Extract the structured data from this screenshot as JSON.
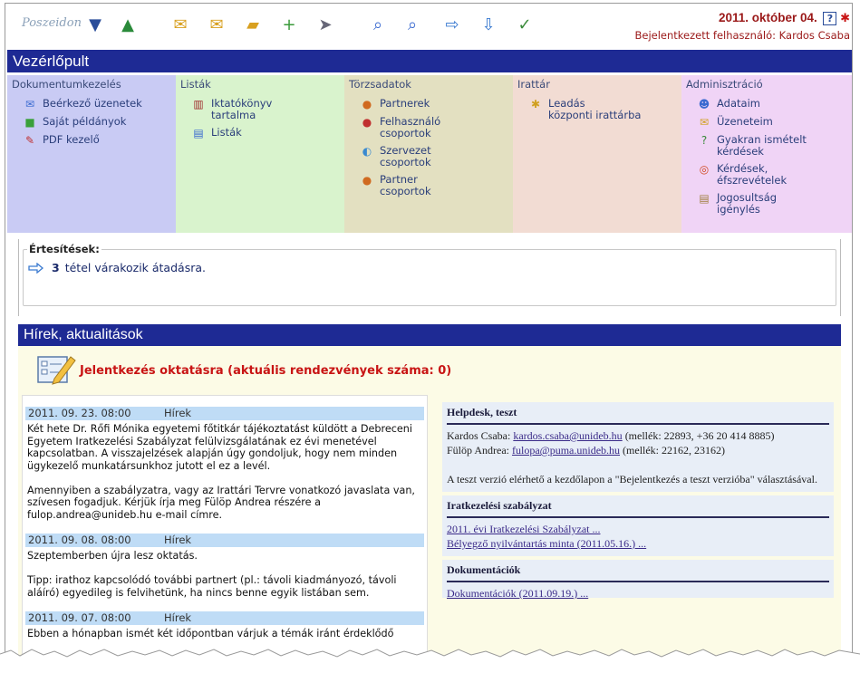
{
  "logo": {
    "text": "Poszeidon"
  },
  "header": {
    "date": "2011. október 04.",
    "user": "Bejelentkezett felhasználó: Kardos Csaba",
    "help_label": "?"
  },
  "icons": {
    "help": "help-icon",
    "logout": "logout-icon"
  },
  "toolbar": [
    {
      "name": "incoming-doc-icon",
      "glyph": "▼"
    },
    {
      "name": "outgoing-doc-icon",
      "glyph": "▲"
    },
    {
      "name": "folder-mail-icon",
      "glyph": "✉"
    },
    {
      "name": "folder-open-mail-icon",
      "glyph": "✉"
    },
    {
      "name": "folder-icon",
      "glyph": "▰"
    },
    {
      "name": "folder-add-icon",
      "glyph": "+"
    },
    {
      "name": "send-icon",
      "glyph": "➤"
    },
    {
      "name": "search-icon",
      "glyph": "⌕"
    },
    {
      "name": "search-detail-icon",
      "glyph": "⌕"
    },
    {
      "name": "arrow-right-icon",
      "glyph": "⇨"
    },
    {
      "name": "arrow-down-icon",
      "glyph": "⇩"
    },
    {
      "name": "checklist-icon",
      "glyph": "✓"
    }
  ],
  "control_panel": {
    "title": "Vezérlőpult"
  },
  "panels": [
    {
      "title": "Dokumentumkezelés",
      "color": "#c9cbf4",
      "items": [
        {
          "label": "Beérkező üzenetek",
          "icon": "inbox-icon",
          "glyph": "✉",
          "color": "#3a6ad0"
        },
        {
          "label": "Saját példányok",
          "icon": "folder-icon",
          "glyph": "■",
          "color": "#3aa03a"
        },
        {
          "label": "PDF kezelő",
          "icon": "pdf-icon",
          "glyph": "✎",
          "color": "#c03030"
        }
      ]
    },
    {
      "title": "Listák",
      "color": "#d9f3cd",
      "items": [
        {
          "label": "Iktatókönyv\ntartalma",
          "icon": "books-icon",
          "glyph": "▥",
          "color": "#a03030"
        },
        {
          "label": "Listák",
          "icon": "list-icon",
          "glyph": "▤",
          "color": "#3a6ad0"
        }
      ]
    },
    {
      "title": "Törzsadatok",
      "color": "#e3e0c1",
      "items": [
        {
          "label": "Partnerek",
          "icon": "partners-icon",
          "glyph": "●",
          "color": "#d06a20"
        },
        {
          "label": "Felhasználó\ncsoportok",
          "icon": "user-groups-icon",
          "glyph": "●",
          "color": "#c03030"
        },
        {
          "label": "Szervezet\ncsoportok",
          "icon": "organization-icon",
          "glyph": "◐",
          "color": "#3a8ad0"
        },
        {
          "label": "Partner\ncsoportok",
          "icon": "partner-groups-icon",
          "glyph": "●",
          "color": "#d06a20"
        }
      ]
    },
    {
      "title": "Irattár",
      "color": "#f2dcd3",
      "items": [
        {
          "label": "Leadás\nközponti irattárba",
          "icon": "archive-icon",
          "glyph": "✱",
          "color": "#d0a020"
        }
      ]
    },
    {
      "title": "Adminisztráció",
      "color": "#f0d4f6",
      "items": [
        {
          "label": "Adataim",
          "icon": "user-icon",
          "glyph": "☻",
          "color": "#3a6ad0"
        },
        {
          "label": "Üzeneteim",
          "icon": "messages-icon",
          "glyph": "✉",
          "color": "#d0a020"
        },
        {
          "label": "Gyakran ismételt\nkérdések",
          "icon": "faq-icon",
          "glyph": "?",
          "color": "#3a8a3a"
        },
        {
          "label": "Kérdések,\néfszrevételek",
          "icon": "lifebuoy-icon",
          "glyph": "◎",
          "color": "#d04a20"
        },
        {
          "label": "Jogosultság\nigénylés",
          "icon": "permission-icon",
          "glyph": "▤",
          "color": "#a08040"
        }
      ]
    }
  ],
  "notifications": {
    "title": "Értesítések:",
    "count": "3",
    "text": "tétel várakozik átadásra."
  },
  "news": {
    "title": "Hírek, aktualitások",
    "event_text": "Jelentkezés oktatásra (aktuális rendezvények száma: 0)",
    "items": [
      {
        "date": "2011. 09. 23. 08:00",
        "category": "Hírek",
        "body": "Két hete Dr. Rőfi Mónika egyetemi főtitkár tájékoztatást küldött a Debreceni Egyetem Iratkezelési Szabályzat felülvizsgálatának ez évi menetével kapcsolatban. A visszajelzések alapján úgy gondoljuk, hogy nem minden ügykezelő munkatársunkhoz jutott el ez a levél.\n\nAmennyiben a szabályzatra, vagy az Irattári Tervre vonatkozó javaslata van, szívesen fogadjuk. Kérjük írja meg Fülöp Andrea részére a fulop.andrea@unideb.hu e-mail címre."
      },
      {
        "date": "2011. 09. 08. 08:00",
        "category": "Hírek",
        "body": "Szeptemberben újra lesz oktatás.\n\nTipp: irathoz kapcsolódó további partnert (pl.: távoli kiadmányozó, távoli aláíró) egyedileg is felvihetünk, ha nincs benne egyik listában sem."
      },
      {
        "date": "2011. 09. 07. 08:00",
        "category": "Hírek",
        "body": "Ebben a hónapban ismét két időpontban várjuk a témák iránt érdeklődő"
      }
    ]
  },
  "sidebar": {
    "helpdesk": {
      "title": "Helpdesk, teszt",
      "line1_name": "Kardos Csaba:",
      "line1_email": "kardos.csaba@unideb.hu",
      "line1_tail": "(mellék: 22893, +36 20 414 8885)",
      "line2_name": "Fülöp Andrea:",
      "line2_email": "fulopa@puma.unideb.hu",
      "line2_tail": "(mellék: 22162, 23162)",
      "note": "A teszt verzió elérhető a kezdőlapon a \"Bejelentkezés a teszt verzióba\" választásával."
    },
    "rules": {
      "title": "Iratkezelési szabályzat",
      "link1": "2011. évi Iratkezelési Szabályzat ...",
      "link2": "Bélyegző nyilvántartás minta (2011.05.16.) ..."
    },
    "docs": {
      "title": "Dokumentációk",
      "link1": "Dokumentációk (2011.09.19.) ..."
    }
  }
}
